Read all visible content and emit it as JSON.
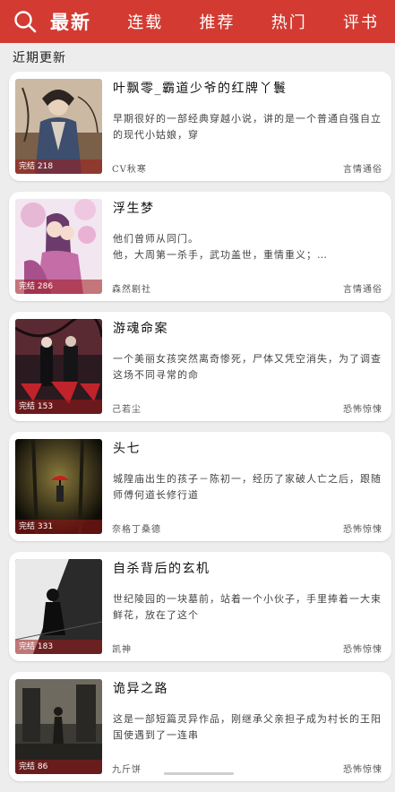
{
  "colors": {
    "accent": "#d33a31",
    "background": "#ededed"
  },
  "header": {
    "search_icon": "search-icon",
    "tabs": [
      {
        "label": "最新",
        "active": true
      },
      {
        "label": "连载",
        "active": false
      },
      {
        "label": "推荐",
        "active": false
      },
      {
        "label": "热门",
        "active": false
      },
      {
        "label": "评书",
        "active": false
      }
    ]
  },
  "section": {
    "title": "近期更新"
  },
  "books": [
    {
      "title": "叶飘零_霸道少爷的红牌丫鬟",
      "status": "完结 218",
      "description": "早期很好的一部经典穿越小说，讲的是一个普通自强自立的现代小姑娘，穿",
      "author": "CV秋寒",
      "category": "言情通俗"
    },
    {
      "title": "浮生梦",
      "status": "完结 286",
      "description": "他们曾师从同门。\n他，大周第一杀手，武功盖世，重情重义；…",
      "author": "森然剧社",
      "category": "言情通俗"
    },
    {
      "title": "游魂命案",
      "status": "完结 153",
      "description": "一个美丽女孩突然离奇惨死，尸体又凭空消失，为了调查这场不同寻常的命",
      "author": "己若尘",
      "category": "恐怖惊悚"
    },
    {
      "title": "头七",
      "status": "完结 331",
      "description": "城隍庙出生的孩子－陈初一，经历了家破人亡之后，跟随师傅何道长修行道",
      "author": "奈格丁桑德",
      "category": "恐怖惊悚"
    },
    {
      "title": "自杀背后的玄机",
      "status": "完结 183",
      "description": "世纪陵园的一块墓前，站着一个小伙子，手里捧着一大束鲜花，放在了这个",
      "author": "凯神",
      "category": "恐怖惊悚"
    },
    {
      "title": "诡异之路",
      "status": "完结 86",
      "description": "这是一部短篇灵异作品，刚继承父亲担子成为村长的王阳国使遇到了一连串",
      "author": "九斤饼",
      "category": "恐怖惊悚"
    }
  ]
}
